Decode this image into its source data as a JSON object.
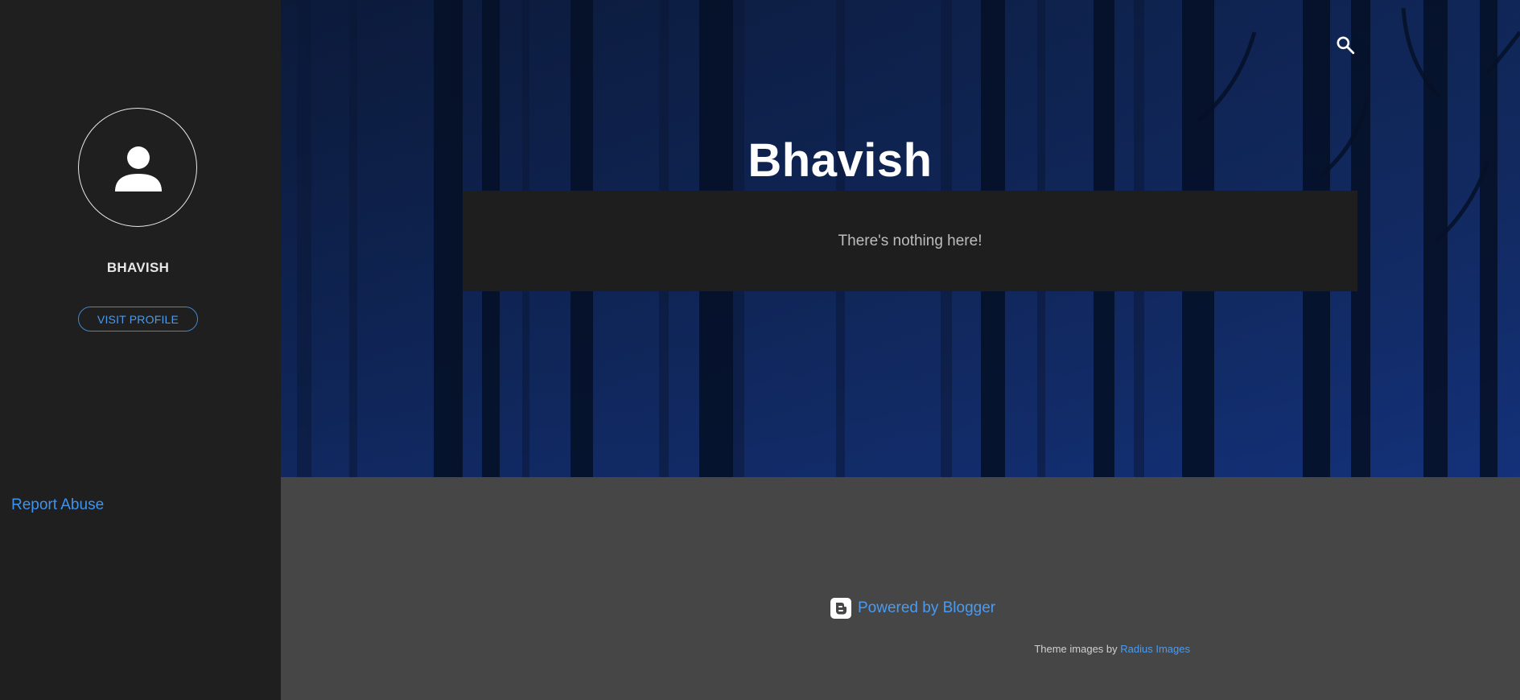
{
  "sidebar": {
    "profile_name": "BHAVISH",
    "visit_profile_label": "VISIT PROFILE",
    "report_abuse_label": "Report Abuse"
  },
  "header": {
    "blog_title": "Bhavish",
    "search_icon": "search-icon"
  },
  "main": {
    "empty_message": "There's nothing here!"
  },
  "footer": {
    "powered_by_label": "Powered by Blogger",
    "theme_credit_prefix": "Theme images by",
    "theme_credit_link": "Radius Images"
  },
  "colors": {
    "sidebar_bg": "#1f1f1f",
    "footer_bg": "#464646",
    "link": "#4a9bf0",
    "hero_tint": "#163581"
  }
}
